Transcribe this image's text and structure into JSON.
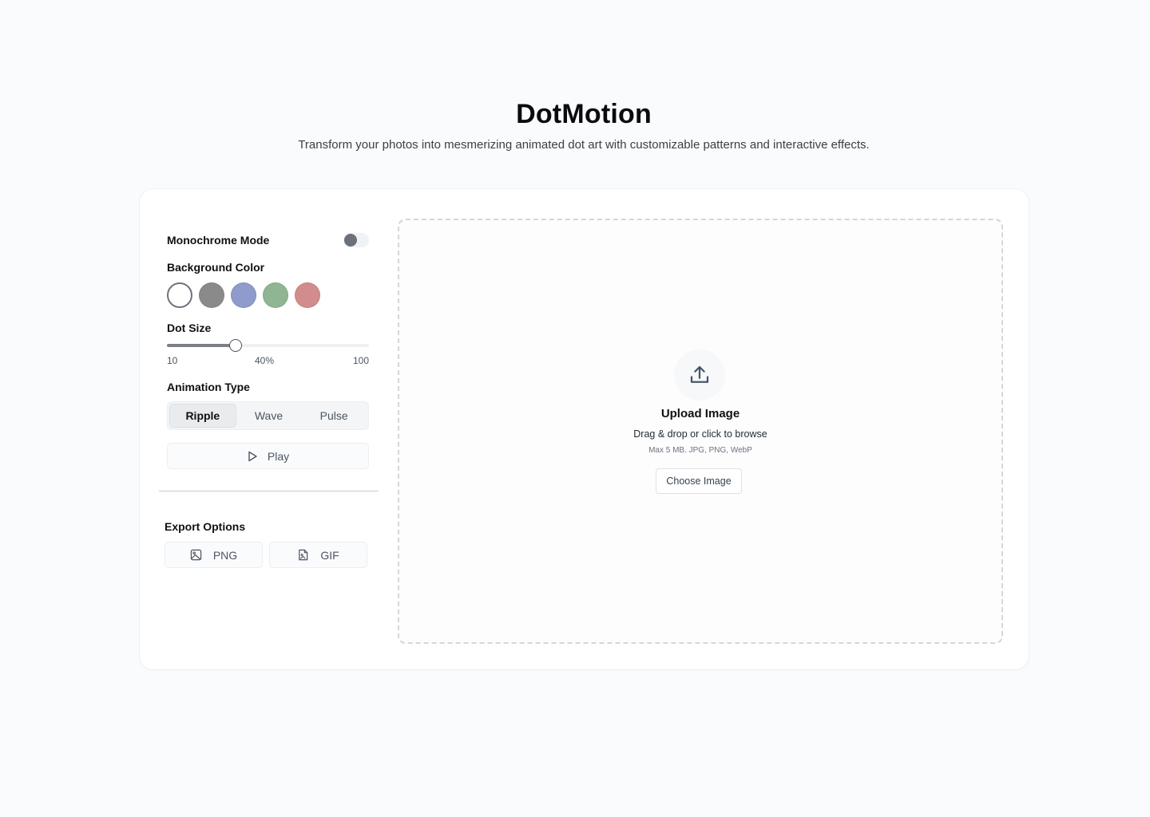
{
  "header": {
    "title": "DotMotion",
    "subtitle": "Transform your photos into mesmerizing animated dot art with customizable patterns and interactive effects."
  },
  "controls": {
    "monochrome_label": "Monochrome Mode",
    "monochrome_on": false,
    "background_label": "Background Color",
    "swatches": [
      {
        "name": "white",
        "color": "#ffffff",
        "selected": true
      },
      {
        "name": "gray",
        "color": "#8a8a8a",
        "selected": false
      },
      {
        "name": "blue",
        "color": "#8e9bcc",
        "selected": false
      },
      {
        "name": "green",
        "color": "#8fb592",
        "selected": false
      },
      {
        "name": "rose",
        "color": "#d18c8b",
        "selected": false
      }
    ],
    "dot_size_label": "Dot Size",
    "dot_size": {
      "min_label": "10",
      "value_label": "40%",
      "max_label": "100",
      "percent": 34
    },
    "animation_label": "Animation Type",
    "animation_types": [
      "Ripple",
      "Wave",
      "Pulse"
    ],
    "animation_selected": "Ripple",
    "play_label": "Play"
  },
  "export": {
    "label": "Export Options",
    "png_label": "PNG",
    "gif_label": "GIF"
  },
  "upload": {
    "title": "Upload Image",
    "hint": "Drag & drop or click to browse",
    "limits": "Max 5 MB. JPG, PNG, WebP",
    "button_label": "Choose Image"
  }
}
